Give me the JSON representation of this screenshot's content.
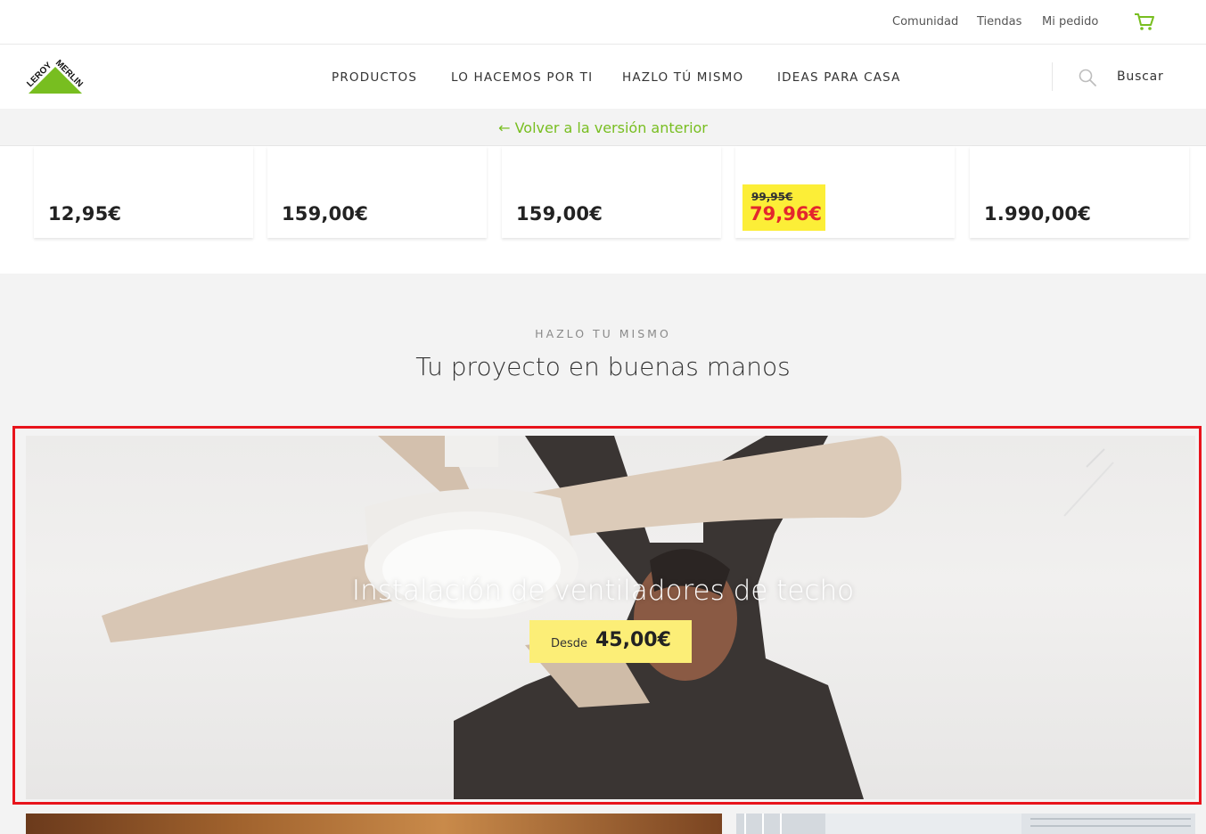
{
  "topbar": {
    "links": [
      "Comunidad",
      "Tiendas",
      "Mi pedido"
    ]
  },
  "logo": {
    "text_top": "LEROY",
    "text_bottom": "MERLIN"
  },
  "nav": {
    "items": [
      "PRODUCTOS",
      "LO HACEMOS POR TI",
      "HAZLO TÚ MISMO",
      "IDEAS PARA CASA"
    ],
    "search_label": "Buscar"
  },
  "back_link": "← Volver a la versión anterior",
  "products": [
    {
      "price": "12,95€"
    },
    {
      "price": "159,00€"
    },
    {
      "price": "159,00€"
    },
    {
      "old_price": "99,95€",
      "price": "79,96€"
    },
    {
      "price": "1.990,00€"
    }
  ],
  "section": {
    "eyebrow": "HAZLO TU MISMO",
    "title": "Tu proyecto en buenas manos"
  },
  "hero": {
    "title": "Instalación de ventiladores de techo",
    "from_label": "Desde",
    "price": "45,00€"
  },
  "colors": {
    "brand_green": "#78be20",
    "promo_yellow": "#fcee37",
    "sale_red": "#e3262d",
    "highlight_red": "#e8141c"
  },
  "icons": [
    "cart-icon",
    "search-icon",
    "arrow-left-icon",
    "leroy-merlin-logo"
  ]
}
